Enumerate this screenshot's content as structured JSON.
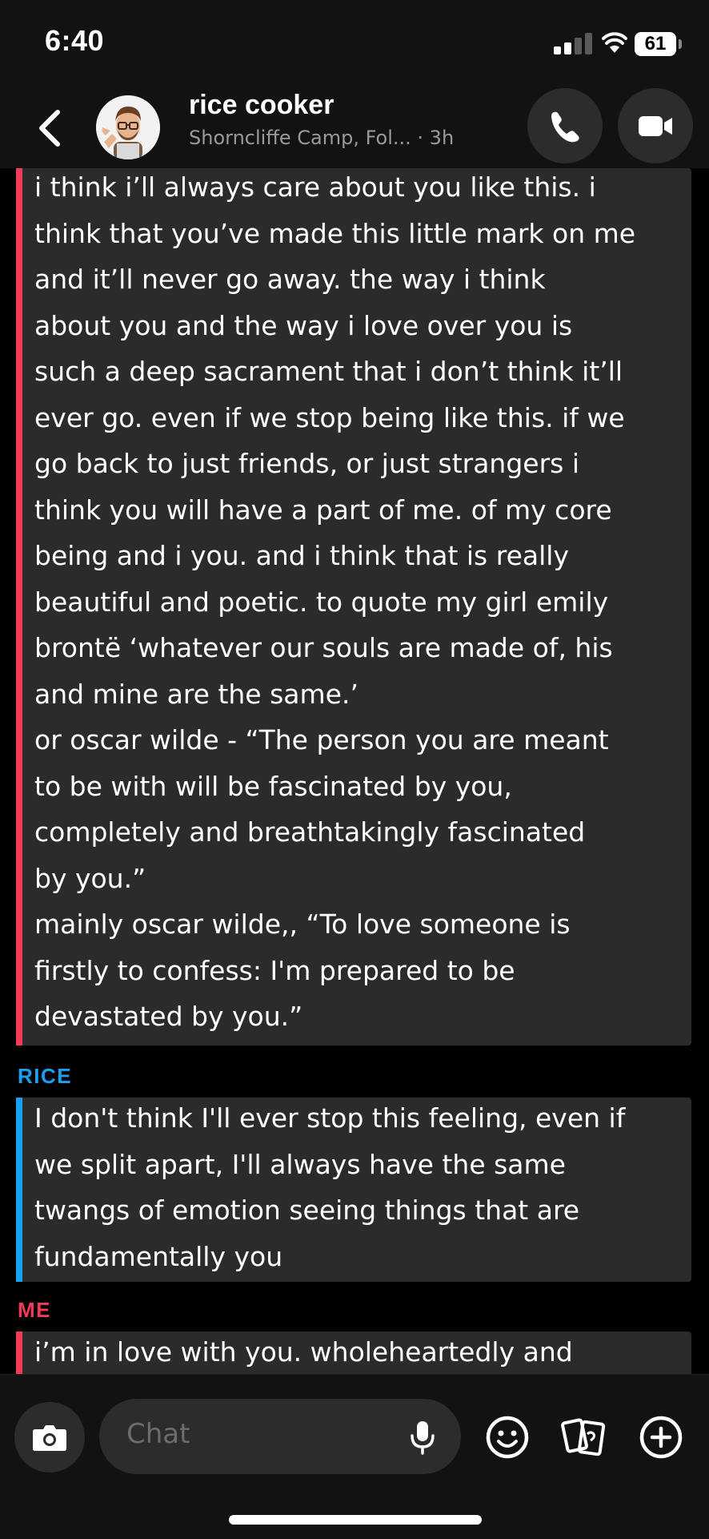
{
  "status_bar": {
    "time": "6:40",
    "battery": "61"
  },
  "header": {
    "contact_name": "rice cooker",
    "location": "Shorncliffe Camp, Fol...",
    "time_ago": "· 3h",
    "back_icon": "chevron-left-icon",
    "call_icon": "phone-icon",
    "video_icon": "video-camera-icon"
  },
  "conversation": {
    "messages": [
      {
        "sender": "",
        "bar_color": "#f23c57",
        "lines": [
          "i think i’ll always care about you like this. i",
          "think that you’ve made this little mark on me",
          "and it’ll never go away. the way i think",
          "about you and the way i love over you is",
          "such a deep sacrament that i don’t think it’ll",
          "ever go. even if we stop being like this. if we",
          "go back to just friends, or just strangers i",
          "think you will have a part of me. of my core",
          "being and i you. and i think that is really",
          "beautiful and poetic. to quote my girl emily",
          "brontë ‘whatever our souls are made of, his",
          "and mine are the same.’",
          "or oscar wilde - “The person you are meant",
          "to be with will be fascinated by you,",
          "completely and breathtakingly fascinated",
          "by you.”",
          "mainly oscar wilde,, “To love someone is",
          "firstly to confess: I'm prepared to be",
          "devastated by you.”"
        ]
      },
      {
        "sender": "RICE",
        "sender_color": "#1aa0f0",
        "bar_color": "#1aa0f0",
        "lines": [
          "I don't think I'll ever stop this feeling, even if",
          "we split apart, I'll always have the same",
          "twangs of emotion seeing things that are",
          "fundamentally you"
        ]
      },
      {
        "sender": "ME",
        "sender_color": "#f23c57",
        "bar_color": "#f23c57",
        "lines": [
          "i’m in love with you. wholeheartedly and"
        ]
      }
    ]
  },
  "composer": {
    "placeholder": "Chat",
    "camera_icon": "camera-icon",
    "mic_icon": "microphone-icon",
    "emoji_icon": "smiley-icon",
    "stickers_icon": "cards-icon",
    "plus_icon": "plus-circle-icon"
  },
  "colors": {
    "me_accent": "#f23c57",
    "friend_accent": "#1aa0f0",
    "bubble_bg": "#2b2b2d"
  }
}
